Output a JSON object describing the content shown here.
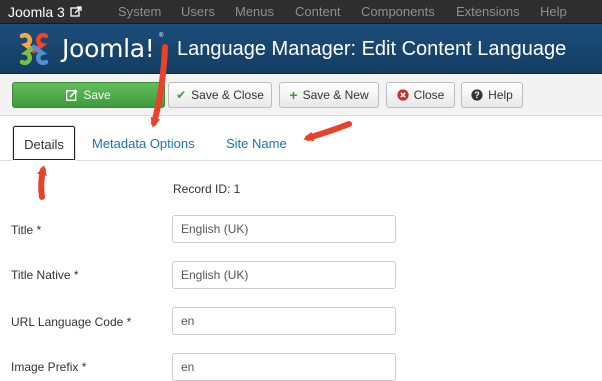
{
  "topnav": {
    "brand": "Joomla 3",
    "items": [
      "System",
      "Users",
      "Menus",
      "Content",
      "Components",
      "Extensions",
      "Help"
    ]
  },
  "header": {
    "logo_text": "Joomla!",
    "logo_mark": "®",
    "title": "Language Manager: Edit Content Language"
  },
  "toolbar": {
    "save": "Save",
    "save_close": "Save & Close",
    "save_new": "Save & New",
    "close": "Close",
    "help": "Help"
  },
  "tabs": {
    "details": "Details",
    "metadata": "Metadata Options",
    "site_name": "Site Name"
  },
  "form": {
    "record_id": "Record ID: 1",
    "title_label": "Title *",
    "title_value": "English (UK)",
    "title_native_label": "Title Native *",
    "title_native_value": "English (UK)",
    "url_code_label": "URL Language Code *",
    "url_code_value": "en",
    "image_prefix_label": "Image Prefix *",
    "image_prefix_value": "en"
  },
  "colors": {
    "topnav_bg": "#2e2e2e",
    "header_bg": "#16436c",
    "save_green": "#4aa847",
    "link_blue": "#1a72b8",
    "arrow_red": "#e8432a"
  }
}
